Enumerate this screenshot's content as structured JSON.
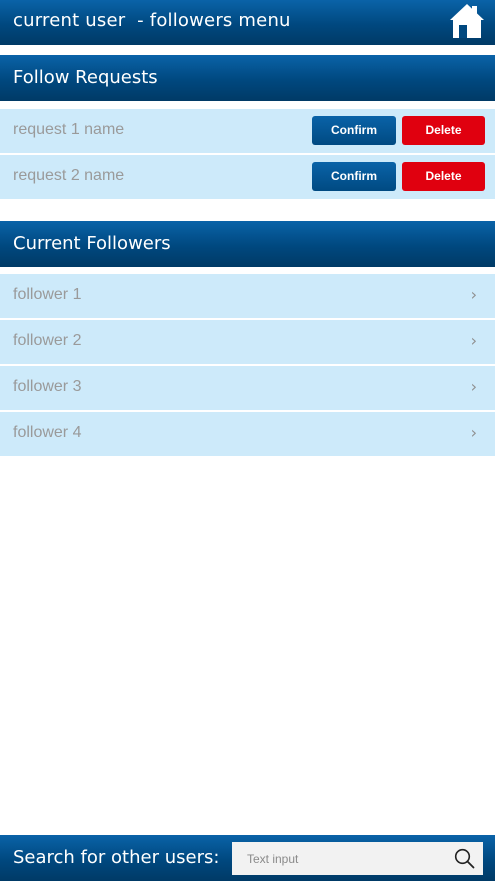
{
  "header": {
    "title": "current user  - followers menu",
    "home_icon": "home-icon"
  },
  "follow_requests": {
    "title": "Follow Requests",
    "confirm_label": "Confirm",
    "delete_label": "Delete",
    "items": [
      {
        "name": "request 1 name"
      },
      {
        "name": "request 2 name"
      }
    ]
  },
  "current_followers": {
    "title": "Current Followers",
    "items": [
      {
        "name": "follower 1"
      },
      {
        "name": "follower 2"
      },
      {
        "name": "follower 3"
      },
      {
        "name": "follower 4"
      }
    ],
    "chevron_icon": "chevron-right-icon"
  },
  "search": {
    "label": "Search for other users:",
    "placeholder": "Text input",
    "value": "",
    "icon": "search-icon"
  },
  "colors": {
    "header_blue": "#00487f",
    "row_background": "#cdeafa",
    "delete_red": "#e0000f"
  }
}
